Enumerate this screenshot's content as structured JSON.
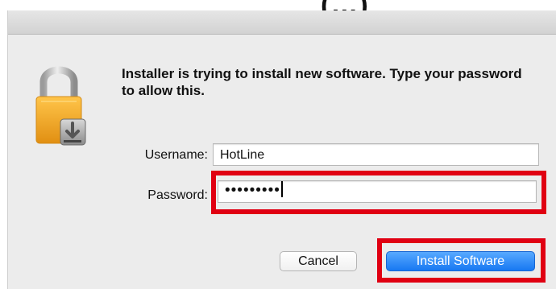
{
  "partial_header_text": "(…)",
  "dialog": {
    "message": "Installer is trying to install new software. Type your password to allow this.",
    "icon": "lock-icon",
    "username": {
      "label": "Username:",
      "value": "HotLine"
    },
    "password": {
      "label": "Password:",
      "masked_value": "•••••••••"
    },
    "buttons": {
      "cancel": "Cancel",
      "install": "Install Software"
    }
  },
  "colors": {
    "dialog_background": "#ececec",
    "primary_button": "#1778f2",
    "highlight": "#e00012",
    "lock_body": "#f0a928"
  }
}
